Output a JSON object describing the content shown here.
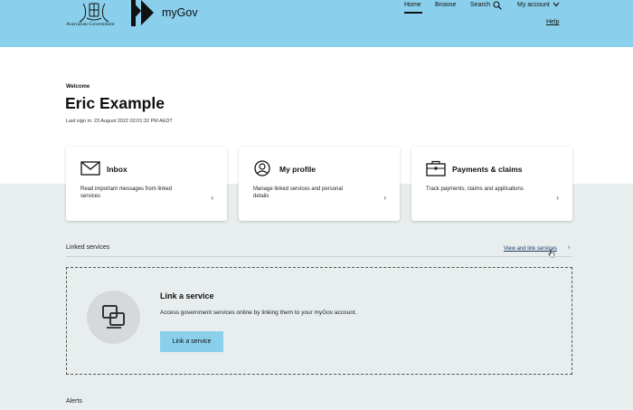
{
  "header": {
    "gov_name": "Australian Government",
    "brand": "myGov",
    "nav": {
      "home": "Home",
      "browse": "Browse",
      "search": "Search",
      "account": "My account"
    },
    "help": "Help"
  },
  "hero": {
    "welcome": "Welcome",
    "user_name": "Eric Example",
    "last_sign_in": "Last sign in: 23 August 2022 02:01:32 PM AEDT"
  },
  "cards": [
    {
      "title": "Inbox",
      "description": "Read important messages from linked services",
      "icon": "envelope-icon"
    },
    {
      "title": "My profile",
      "description": "Manage linked services and personal details",
      "icon": "profile-icon"
    },
    {
      "title": "Payments & claims",
      "description": "Track payments, claims and applications",
      "icon": "briefcase-icon"
    }
  ],
  "linked_services": {
    "title": "Linked services",
    "view_link": "View and link services",
    "box_title": "Link a service",
    "box_desc": "Access government services online by linking them to your myGov account.",
    "button": "Link a service"
  },
  "alerts": {
    "title": "Alerts"
  },
  "colors": {
    "header_bg": "#8ad0ec",
    "button_bg": "#8ad0ec",
    "page_bg": "#e8eeee"
  }
}
